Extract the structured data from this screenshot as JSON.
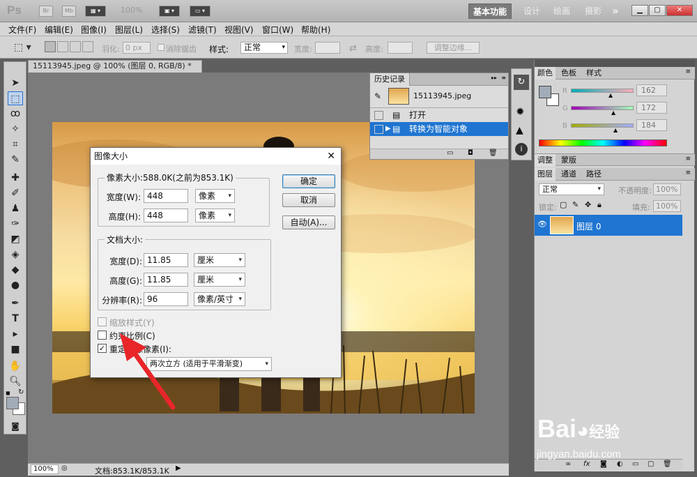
{
  "app": {
    "logo": "Ps",
    "bridge_label": "Br",
    "mini_label": "Mb",
    "zoom": "100%",
    "workspaces": [
      "基本功能",
      "设计",
      "绘画",
      "摄影"
    ],
    "more": "»"
  },
  "menu": [
    "文件(F)",
    "编辑(E)",
    "图像(I)",
    "图层(L)",
    "选择(S)",
    "滤镜(T)",
    "视图(V)",
    "窗口(W)",
    "帮助(H)"
  ],
  "options": {
    "feather_label": "羽化:",
    "feather_value": "0 px",
    "antialias_label": "消除锯齿",
    "style_label": "样式:",
    "style_value": "正常",
    "width_label": "宽度:",
    "height_label": "高度:",
    "refine_button": "调整边缘..."
  },
  "document": {
    "tab_title": "15113945.jpeg @ 100% (图层 0, RGB/8) *",
    "close": "×",
    "status_zoom": "100%",
    "status_doc": "文档:853.1K/853.1K"
  },
  "history": {
    "title": "历史记录",
    "snapshot_name": "15113945.jpeg",
    "items": [
      "打开",
      "转换为智能对象"
    ]
  },
  "dialog": {
    "title": "图像大小",
    "pixel_dimensions": "像素大小:588.0K(之前为853.1K)",
    "px_width_label": "宽度(W):",
    "px_width_value": "448",
    "px_width_unit": "像素",
    "px_height_label": "高度(H):",
    "px_height_value": "448",
    "px_height_unit": "像素",
    "doc_size": "文档大小:",
    "doc_width_label": "宽度(D):",
    "doc_width_value": "11.85",
    "doc_width_unit": "厘米",
    "doc_height_label": "高度(G):",
    "doc_height_value": "11.85",
    "doc_height_unit": "厘米",
    "resolution_label": "分辨率(R):",
    "resolution_value": "96",
    "resolution_unit": "像素/英寸",
    "scale_styles": "缩放样式(Y)",
    "constrain": "约束比例(C)",
    "resample": "重定图像像素(I):",
    "resample_method": "两次立方 (适用于平滑渐变)",
    "ok": "确定",
    "cancel": "取消",
    "auto": "自动(A)..."
  },
  "color_panel": {
    "tabs": [
      "颜色",
      "色板",
      "样式"
    ],
    "r_label": "R",
    "r_value": "162",
    "g_label": "G",
    "g_value": "172",
    "b_label": "B",
    "b_value": "184",
    "fg_color": "#a2acb8"
  },
  "adjust_panel": {
    "tabs": [
      "调整",
      "蒙版"
    ]
  },
  "layers_panel": {
    "tabs": [
      "图层",
      "通道",
      "路径"
    ],
    "blend_mode": "正常",
    "opacity_label": "不透明度:",
    "opacity_value": "100%",
    "lock_label": "锁定:",
    "fill_label": "填充:",
    "fill_value": "100%",
    "layer_name": "图层 0"
  },
  "watermark": {
    "big": "Bai",
    "brand": "经验",
    "small": "jingyan.baidu.com"
  }
}
